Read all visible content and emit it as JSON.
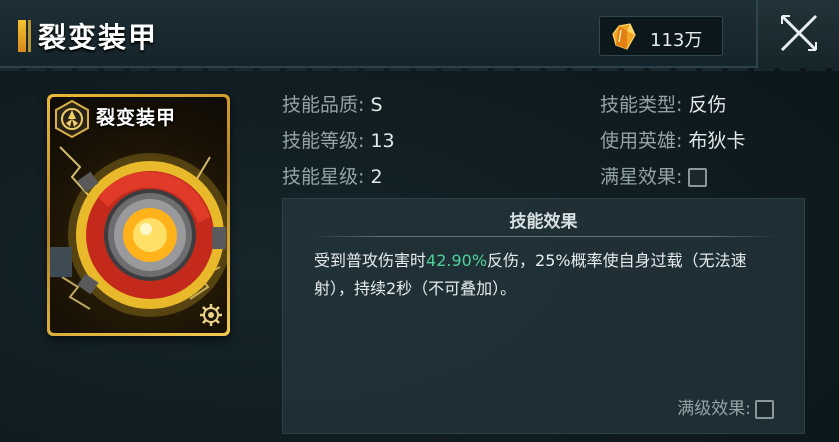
{
  "header": {
    "title": "裂变装甲",
    "currency_value": "113万",
    "currency_icon": "crystal-icon",
    "close_icon": "close-icon"
  },
  "card": {
    "title": "裂变装甲",
    "emblem_icon": "hexagon-emblem-icon",
    "badge_icon": "gear-icon"
  },
  "info": {
    "quality_label": "技能品质:",
    "quality_value": "S",
    "level_label": "技能等级:",
    "level_value": "13",
    "star_label": "技能星级:",
    "star_value": "2",
    "type_label": "技能类型:",
    "type_value": "反伤",
    "hero_label": "使用英雄:",
    "hero_value": "布狄卡",
    "fullstar_label": "满星效果:"
  },
  "effect": {
    "title": "技能效果",
    "text_before": "受到普攻伤害时",
    "highlight": "42.90%",
    "text_after": "反伤，25%概率使自身过载（无法速射），持续2秒（不可叠加）。",
    "maxlevel_label": "满级效果:"
  },
  "colors": {
    "accent_gold": "#f5c233",
    "highlight_green": "#4fd199",
    "panel_bg": "#0f1c20"
  }
}
